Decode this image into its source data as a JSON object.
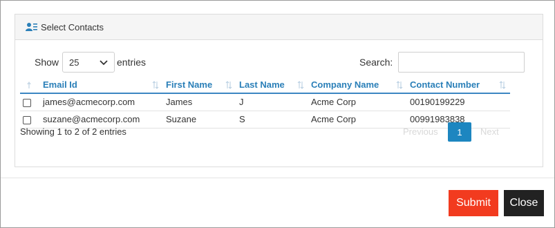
{
  "panel": {
    "title": "Select Contacts",
    "title_icon": "contacts-list-icon"
  },
  "length": {
    "show_label": "Show",
    "selected": "25",
    "entries_label": "entries"
  },
  "search": {
    "label": "Search:",
    "value": ""
  },
  "table": {
    "headers": [
      "Email Id",
      "First Name",
      "Last Name",
      "Company Name",
      "Contact Number"
    ],
    "rows": [
      {
        "email": "james@acmecorp.com",
        "first": "James",
        "last": "J",
        "company": "Acme Corp",
        "phone": "00190199229",
        "checked": false
      },
      {
        "email": "suzane@acmecorp.com",
        "first": "Suzane",
        "last": "S",
        "company": "Acme Corp",
        "phone": "00991983838",
        "checked": false
      }
    ]
  },
  "info": "Showing 1 to 2 of 2 entries",
  "pagination": {
    "previous": "Previous",
    "current": "1",
    "next": "Next"
  },
  "buttons": {
    "submit": "Submit",
    "close": "Close"
  },
  "colors": {
    "accent": "#2a7fb8",
    "submit": "#f23b1f",
    "close": "#222222",
    "page_active": "#1d86c0"
  }
}
